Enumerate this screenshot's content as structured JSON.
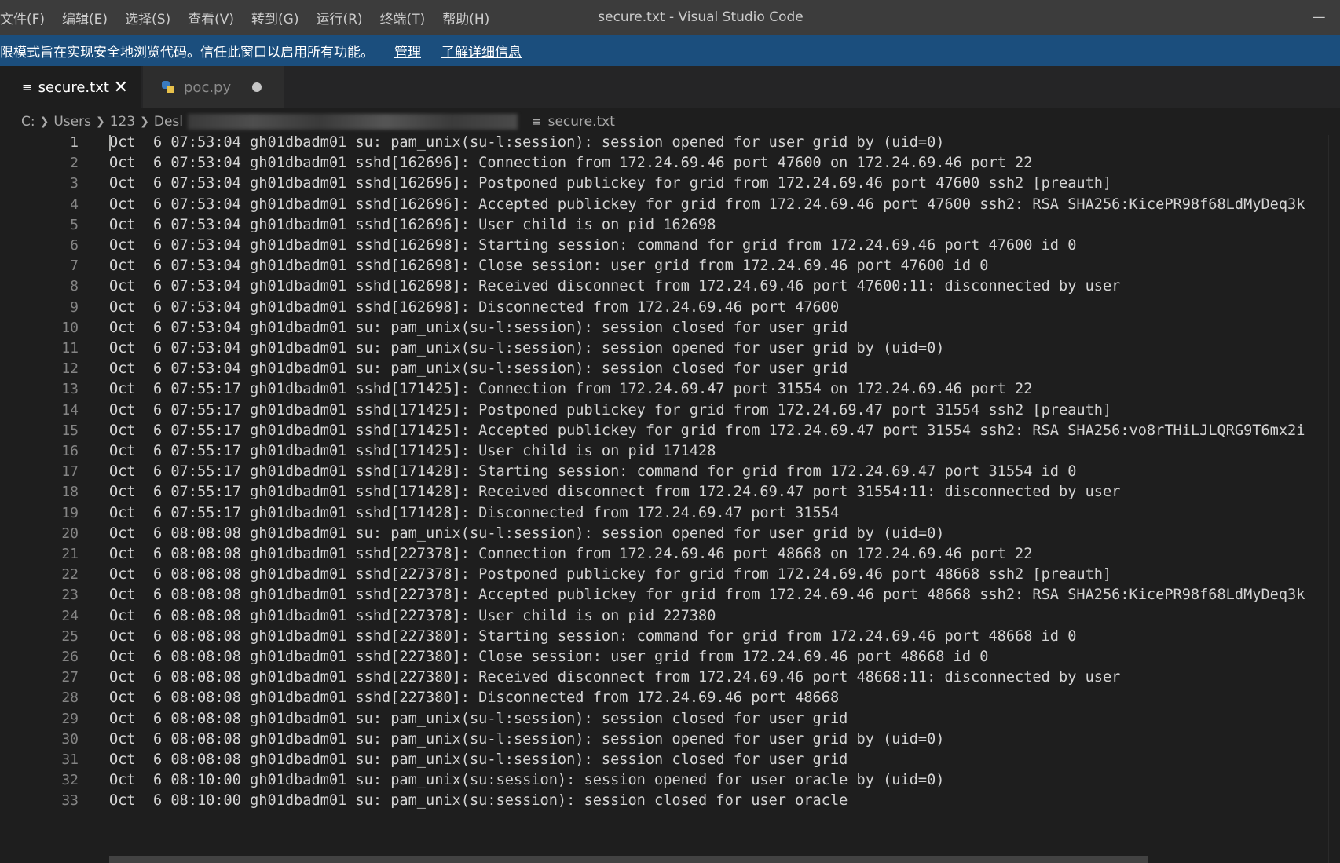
{
  "window": {
    "title": "secure.txt - Visual Studio Code",
    "menu": [
      "文件(F)",
      "编辑(E)",
      "选择(S)",
      "查看(V)",
      "转到(G)",
      "运行(R)",
      "终端(T)",
      "帮助(H)"
    ],
    "minimize_glyph": "—"
  },
  "banner": {
    "text": "限模式旨在实现安全地浏览代码。信任此窗口以启用所有功能。",
    "manage_label": "管理",
    "learn_more_label": "了解详细信息"
  },
  "tabs": [
    {
      "label": "secure.txt",
      "icon": "text-file-icon",
      "state": "active",
      "close_glyph": "✕"
    },
    {
      "label": "poc.py",
      "icon": "python-icon",
      "state": "modified"
    }
  ],
  "breadcrumb": {
    "parts": [
      "C:",
      "Users",
      "123",
      "Desl"
    ],
    "file": "secure.txt"
  },
  "editor": {
    "current_line": 1,
    "lines": [
      "Oct  6 07:53:04 gh01dbadm01 su: pam_unix(su-l:session): session opened for user grid by (uid=0)",
      "Oct  6 07:53:04 gh01dbadm01 sshd[162696]: Connection from 172.24.69.46 port 47600 on 172.24.69.46 port 22",
      "Oct  6 07:53:04 gh01dbadm01 sshd[162696]: Postponed publickey for grid from 172.24.69.46 port 47600 ssh2 [preauth]",
      "Oct  6 07:53:04 gh01dbadm01 sshd[162696]: Accepted publickey for grid from 172.24.69.46 port 47600 ssh2: RSA SHA256:KicePR98f68LdMyDeq3k",
      "Oct  6 07:53:04 gh01dbadm01 sshd[162696]: User child is on pid 162698",
      "Oct  6 07:53:04 gh01dbadm01 sshd[162698]: Starting session: command for grid from 172.24.69.46 port 47600 id 0",
      "Oct  6 07:53:04 gh01dbadm01 sshd[162698]: Close session: user grid from 172.24.69.46 port 47600 id 0",
      "Oct  6 07:53:04 gh01dbadm01 sshd[162698]: Received disconnect from 172.24.69.46 port 47600:11: disconnected by user",
      "Oct  6 07:53:04 gh01dbadm01 sshd[162698]: Disconnected from 172.24.69.46 port 47600",
      "Oct  6 07:53:04 gh01dbadm01 su: pam_unix(su-l:session): session closed for user grid",
      "Oct  6 07:53:04 gh01dbadm01 su: pam_unix(su-l:session): session opened for user grid by (uid=0)",
      "Oct  6 07:53:04 gh01dbadm01 su: pam_unix(su-l:session): session closed for user grid",
      "Oct  6 07:55:17 gh01dbadm01 sshd[171425]: Connection from 172.24.69.47 port 31554 on 172.24.69.46 port 22",
      "Oct  6 07:55:17 gh01dbadm01 sshd[171425]: Postponed publickey for grid from 172.24.69.47 port 31554 ssh2 [preauth]",
      "Oct  6 07:55:17 gh01dbadm01 sshd[171425]: Accepted publickey for grid from 172.24.69.47 port 31554 ssh2: RSA SHA256:vo8rTHiLJLQRG9T6mx2i",
      "Oct  6 07:55:17 gh01dbadm01 sshd[171425]: User child is on pid 171428",
      "Oct  6 07:55:17 gh01dbadm01 sshd[171428]: Starting session: command for grid from 172.24.69.47 port 31554 id 0",
      "Oct  6 07:55:17 gh01dbadm01 sshd[171428]: Received disconnect from 172.24.69.47 port 31554:11: disconnected by user",
      "Oct  6 07:55:17 gh01dbadm01 sshd[171428]: Disconnected from 172.24.69.47 port 31554",
      "Oct  6 08:08:08 gh01dbadm01 su: pam_unix(su-l:session): session opened for user grid by (uid=0)",
      "Oct  6 08:08:08 gh01dbadm01 sshd[227378]: Connection from 172.24.69.46 port 48668 on 172.24.69.46 port 22",
      "Oct  6 08:08:08 gh01dbadm01 sshd[227378]: Postponed publickey for grid from 172.24.69.46 port 48668 ssh2 [preauth]",
      "Oct  6 08:08:08 gh01dbadm01 sshd[227378]: Accepted publickey for grid from 172.24.69.46 port 48668 ssh2: RSA SHA256:KicePR98f68LdMyDeq3k",
      "Oct  6 08:08:08 gh01dbadm01 sshd[227378]: User child is on pid 227380",
      "Oct  6 08:08:08 gh01dbadm01 sshd[227380]: Starting session: command for grid from 172.24.69.46 port 48668 id 0",
      "Oct  6 08:08:08 gh01dbadm01 sshd[227380]: Close session: user grid from 172.24.69.46 port 48668 id 0",
      "Oct  6 08:08:08 gh01dbadm01 sshd[227380]: Received disconnect from 172.24.69.46 port 48668:11: disconnected by user",
      "Oct  6 08:08:08 gh01dbadm01 sshd[227380]: Disconnected from 172.24.69.46 port 48668",
      "Oct  6 08:08:08 gh01dbadm01 su: pam_unix(su-l:session): session closed for user grid",
      "Oct  6 08:08:08 gh01dbadm01 su: pam_unix(su-l:session): session opened for user grid by (uid=0)",
      "Oct  6 08:08:08 gh01dbadm01 su: pam_unix(su-l:session): session closed for user grid",
      "Oct  6 08:10:00 gh01dbadm01 su: pam_unix(su:session): session opened for user oracle by (uid=0)",
      "Oct  6 08:10:00 gh01dbadm01 su: pam_unix(su:session): session closed for user oracle"
    ]
  },
  "colors": {
    "titlebar": "#3c3c3c",
    "banner": "#1b4e7d",
    "editor_bg": "#1e1e1e",
    "line_number": "#858585",
    "text": "#d4d4d4"
  }
}
